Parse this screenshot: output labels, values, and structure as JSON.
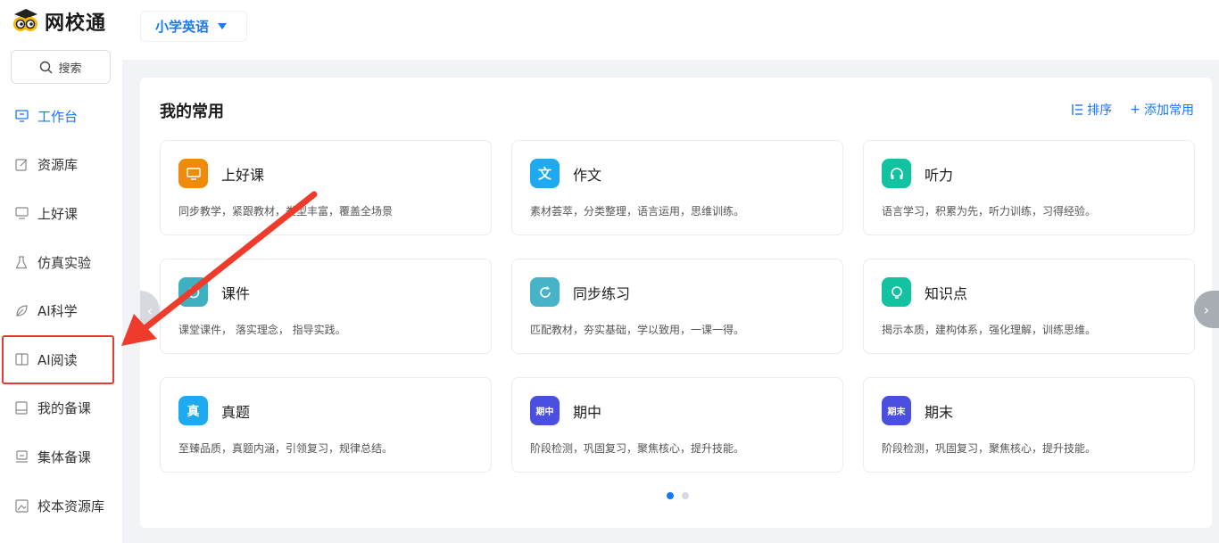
{
  "brand": {
    "name": "网校通",
    "logo_icon": "mascot-logo"
  },
  "search": {
    "label": "搜索"
  },
  "subject": {
    "selected": "小学英语"
  },
  "sidebar": {
    "items": [
      {
        "label": "工作台",
        "icon": "monitor-icon"
      },
      {
        "label": "资源库",
        "icon": "edit-icon"
      },
      {
        "label": "上好课",
        "icon": "screen-icon"
      },
      {
        "label": "仿真实验",
        "icon": "flask-icon"
      },
      {
        "label": "AI科学",
        "icon": "leaf-icon"
      },
      {
        "label": "AI阅读",
        "icon": "book-icon"
      },
      {
        "label": "我的备课",
        "icon": "notebook-icon"
      },
      {
        "label": "集体备课",
        "icon": "group-icon"
      },
      {
        "label": "校本资源库",
        "icon": "image-icon"
      }
    ],
    "active_index": 0,
    "highlight_index": 5
  },
  "panel": {
    "title": "我的常用",
    "sort_label": "排序",
    "add_label": "添加常用",
    "cards": [
      {
        "title": "上好课",
        "desc": "同步教学，紧跟教材，类型丰富，覆盖全场景",
        "icon_color": "#f08a0a",
        "icon_glyph": ""
      },
      {
        "title": "作文",
        "desc": "素材荟萃，分类整理，语言运用，思维训练。",
        "icon_color": "#1eaaf0",
        "icon_glyph": "文"
      },
      {
        "title": "听力",
        "desc": "语言学习，积累为先，听力训练，习得经验。",
        "icon_color": "#13c2a0",
        "icon_glyph": ""
      },
      {
        "title": "课件",
        "desc": "课堂课件， 落实理念， 指导实践。",
        "icon_color": "#3fb0c0",
        "icon_glyph": ""
      },
      {
        "title": "同步练习",
        "desc": "匹配教材，夯实基础，学以致用，一课一得。",
        "icon_color": "#46b3c7",
        "icon_glyph": ""
      },
      {
        "title": "知识点",
        "desc": "揭示本质，建构体系，强化理解，训练思维。",
        "icon_color": "#13c2a0",
        "icon_glyph": ""
      },
      {
        "title": "真题",
        "desc": "至臻品质，真题内涵，引领复习，规律总结。",
        "icon_color": "#1eaaf0",
        "icon_glyph": "真"
      },
      {
        "title": "期中",
        "desc": "阶段检测，巩固复习，聚焦核心，提升技能。",
        "icon_color": "#4a4fe0",
        "icon_glyph": "期中"
      },
      {
        "title": "期末",
        "desc": "阶段检测，巩固复习，聚焦核心，提升技能。",
        "icon_color": "#4a4fe0",
        "icon_glyph": "期末"
      }
    ]
  },
  "pagination": {
    "current": 1,
    "total": 2
  }
}
